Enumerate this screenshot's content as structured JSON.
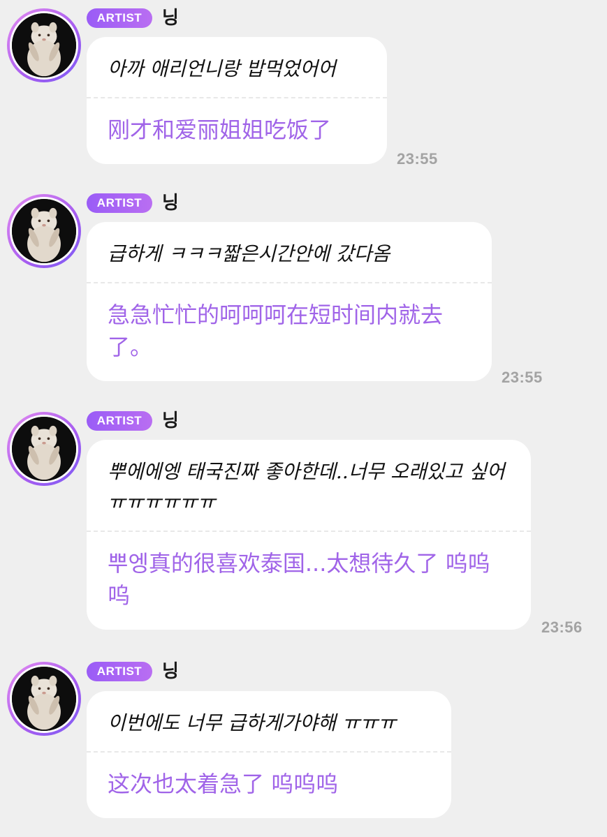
{
  "messages": [
    {
      "badge": "ARTIST",
      "name": "닝",
      "original": "아까 애리언니랑 밥먹었어어",
      "translation": "刚才和爱丽姐姐吃饭了",
      "time": "23:55"
    },
    {
      "badge": "ARTIST",
      "name": "닝",
      "original": "급하게 ㅋㅋㅋ짧은시간안에 갔다옴",
      "translation": "急急忙忙的呵呵呵在短时间内就去了。",
      "time": "23:55"
    },
    {
      "badge": "ARTIST",
      "name": "닝",
      "original": "뿌에에엥 태국진짜 좋아한데..너무 오래있고 싶어 ㅠㅠㅠㅠㅠㅠ",
      "translation": "뿌엥真的很喜欢泰国...太想待久了 呜呜呜",
      "time": "23:56"
    },
    {
      "badge": "ARTIST",
      "name": "닝",
      "original": "이번에도 너무 급하게가야해 ㅠㅠㅠ",
      "translation": "这次也太着急了 呜呜呜",
      "time": ""
    }
  ],
  "colors": {
    "background": "#efefef",
    "badge_gradient_start": "#9a5cf6",
    "translation_text": "#a064e8",
    "timestamp": "#a3a3a3"
  },
  "icons": {
    "avatar": "white-persian-cat-photo"
  }
}
